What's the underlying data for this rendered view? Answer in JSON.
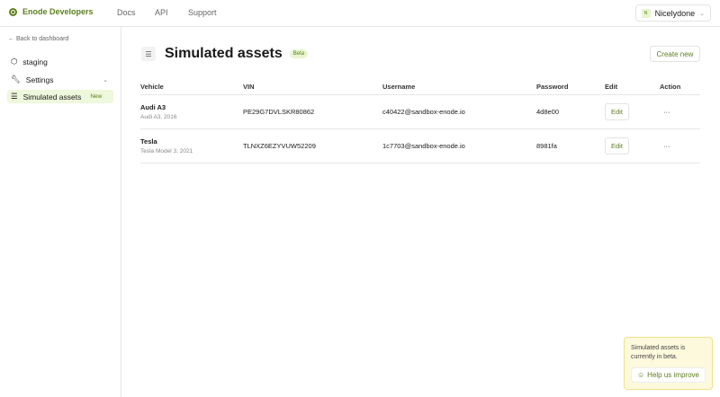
{
  "header": {
    "brand": "Enode Developers",
    "nav": [
      "Docs",
      "API",
      "Support"
    ],
    "user": {
      "initial": "N",
      "name": "Nicelydone"
    }
  },
  "sidebar": {
    "back": "← Back to dashboard",
    "items": [
      {
        "label": "staging"
      },
      {
        "label": "Settings"
      },
      {
        "label": "Simulated assets",
        "badge": "New"
      }
    ]
  },
  "page": {
    "title": "Simulated assets",
    "badge": "Beta",
    "create": "Create new"
  },
  "table": {
    "headers": [
      "Vehicle",
      "VIN",
      "Username",
      "Password",
      "Edit",
      "Action"
    ],
    "rows": [
      {
        "vehicle": "Audi A3",
        "sub": "Audi A3, 2016",
        "vin": "PE29G7DVLSKR80862",
        "username": "c40422@sandbox-enode.io",
        "password": "4d8e00",
        "edit": "Edit",
        "action": "···"
      },
      {
        "vehicle": "Tesla",
        "sub": "Tesla Model 3, 2021",
        "vin": "TLNXZ6EZYVUW52209",
        "username": "1c7703@sandbox-enode.io",
        "password": "8981fa",
        "edit": "Edit",
        "action": "···"
      }
    ]
  },
  "toast": {
    "text": "Simulated assets is currently in beta.",
    "button": "Help us improve"
  }
}
